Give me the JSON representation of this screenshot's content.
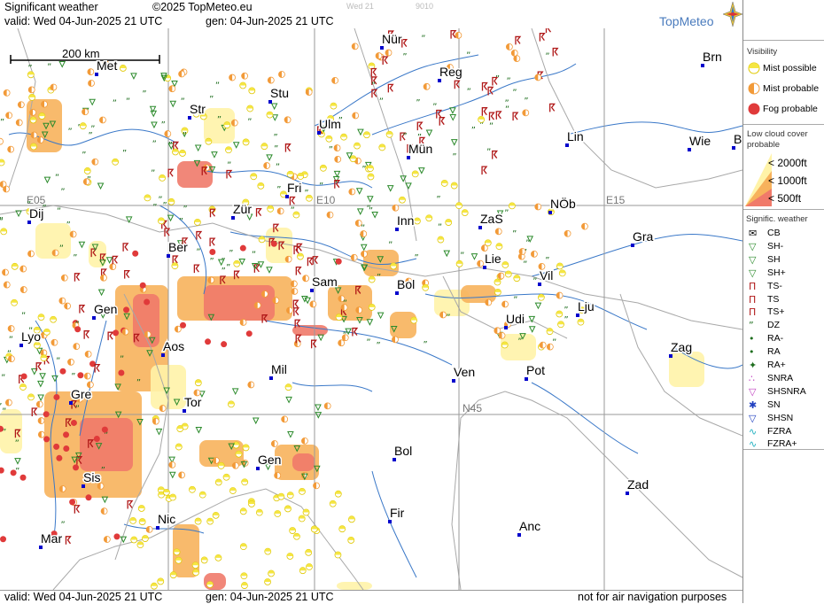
{
  "header": {
    "title": "Significant weather",
    "copyright": "©2025 TopMeteo.eu",
    "valid": "valid:  Wed  04-Jun-2025  21 UTC",
    "gen": "gen: 04-Jun-2025  21 UTC",
    "faint_day": "Wed 21",
    "faint_code": "9010",
    "brand": "TopMeteo"
  },
  "footer": {
    "valid": "valid:  Wed  04-Jun-2025  21 UTC",
    "gen": "gen: 04-Jun-2025  21 UTC",
    "disclaimer": "not for air navigation purposes"
  },
  "map": {
    "scale_label": "200 km",
    "grid_labels": [
      "E05",
      "E10",
      "E15",
      "N45"
    ],
    "cities": [
      "Nür",
      "Brn",
      "Met",
      "Reg",
      "Stu",
      "Str",
      "Ulm",
      "Lin",
      "Wie",
      "B",
      "Mün",
      "Fri",
      "NÖb",
      "Dij",
      "Zür",
      "Inn",
      "ZaS",
      "Gra",
      "Ber",
      "Lie",
      "Vil",
      "Sam",
      "Bol",
      "Lju",
      "Gen",
      "Udi",
      "Lyo",
      "Aos",
      "Zag",
      "Mil",
      "Ven",
      "Pot",
      "Gre",
      "Tor",
      "Gen",
      "Bol",
      "Zad",
      "Sis",
      "Fir",
      "Nic",
      "Anc",
      "Mar"
    ]
  },
  "legend": {
    "visibility_title": "Visibility",
    "visibility": [
      "Mist possible",
      "Mist probable",
      "Fog probable"
    ],
    "cloud_title": [
      "Low cloud cover",
      "probable"
    ],
    "cloud": [
      "< 2000ft",
      "< 1000ft",
      "<   500ft"
    ],
    "sigwx_title": "Signific. weather",
    "sigwx": [
      "CB",
      "SH-",
      "SH",
      "SH+",
      "TS-",
      "TS",
      "TS+",
      "DZ",
      "RA-",
      "RA",
      "RA+",
      "SNRA",
      "SHSNRA",
      "SN",
      "SHSN",
      "FZRA",
      "FZRA+"
    ]
  },
  "colors": {
    "mist_possible": "#f5e642",
    "mist_probable": "#f29a38",
    "fog": "#e03a3a",
    "cloud_2000": "#fff3a8",
    "cloud_1000": "#f7b25c",
    "cloud_500": "#f07a6a",
    "shower": "#2b8a2b",
    "thunder": "#b01818",
    "drizzle": "#1f6e1f",
    "rivers": "#3a78c8",
    "border": "#a8a8a8",
    "grid": "#9a9a9a"
  }
}
